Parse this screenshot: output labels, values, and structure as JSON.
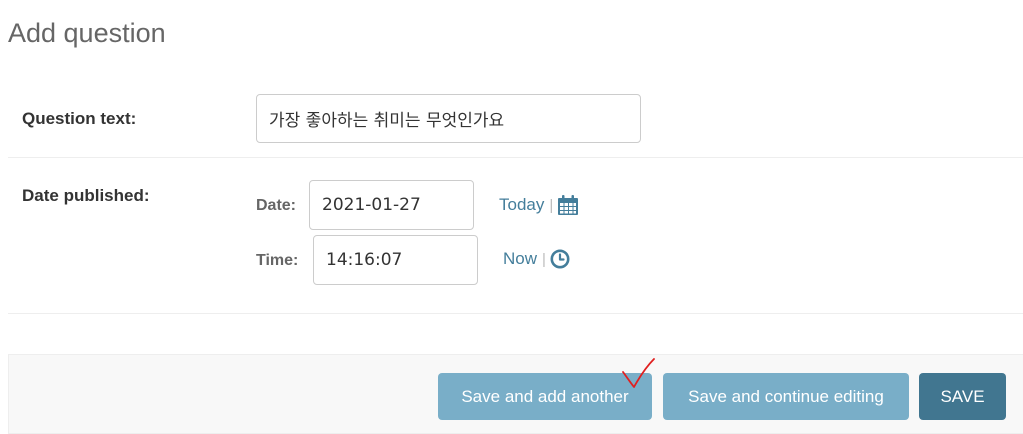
{
  "page": {
    "title": "Add question"
  },
  "form": {
    "question_text": {
      "label": "Question text:",
      "value": "가장 좋아하는 취미는 무엇인가요"
    },
    "date_published": {
      "label": "Date published:",
      "date_label": "Date:",
      "date_value": "2021-01-27",
      "date_shortcut": "Today",
      "date_icon": "calendar-icon",
      "time_label": "Time:",
      "time_value": "14:16:07",
      "time_shortcut": "Now",
      "time_icon": "clock-icon",
      "separator": "|"
    }
  },
  "submit": {
    "save_add_another": "Save and add another",
    "save_continue": "Save and continue editing",
    "save": "SAVE"
  },
  "annotation": {
    "mark": "red-checkmark"
  },
  "colors": {
    "link": "#447e9b",
    "button_secondary": "#79aec8",
    "button_primary": "#417690",
    "annotation": "#e02020"
  }
}
